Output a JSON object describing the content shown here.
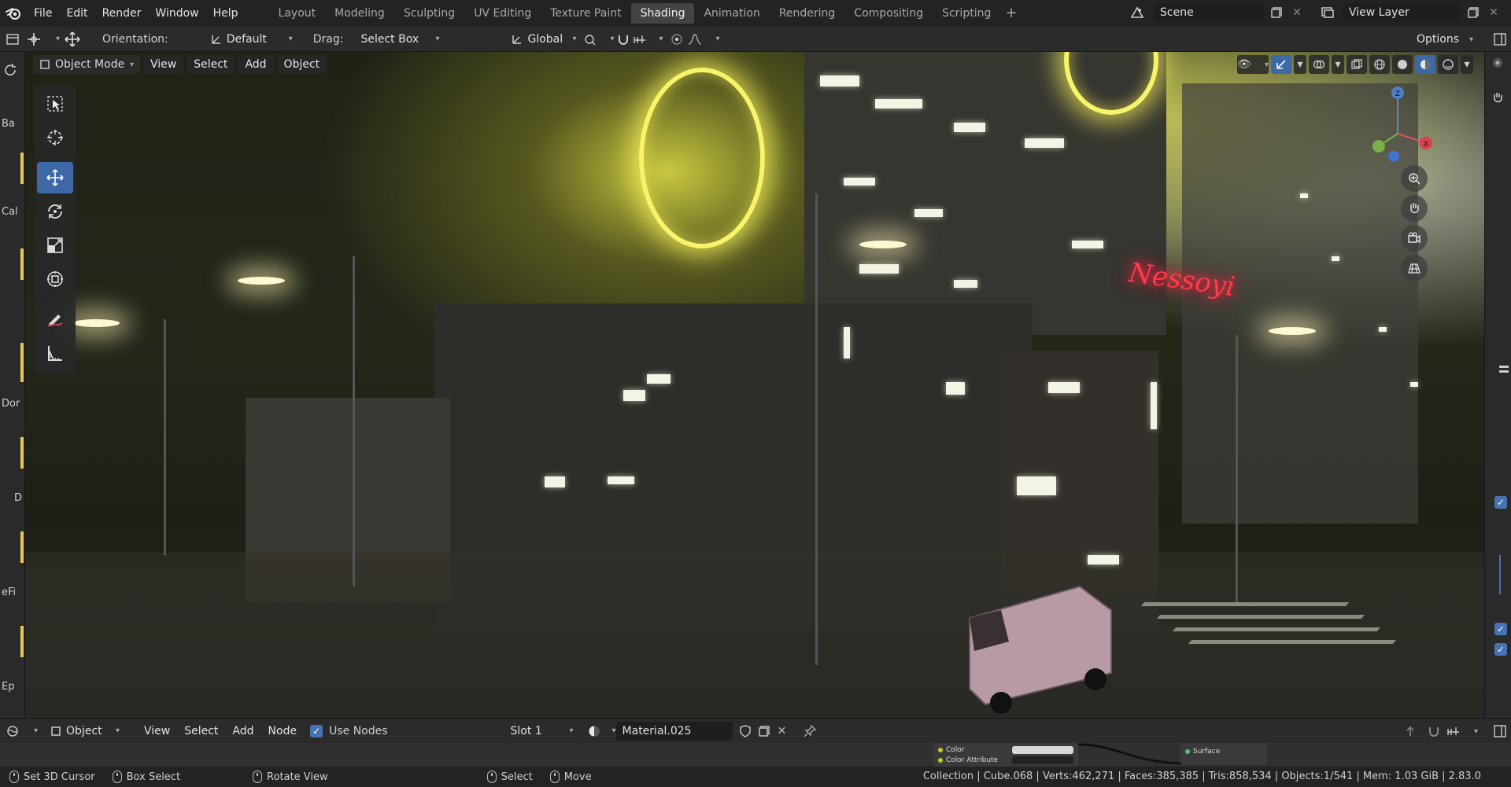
{
  "topbar": {
    "menus": [
      "File",
      "Edit",
      "Render",
      "Window",
      "Help"
    ],
    "workspaces": [
      "Layout",
      "Modeling",
      "Sculpting",
      "UV Editing",
      "Texture Paint",
      "Shading",
      "Animation",
      "Rendering",
      "Compositing",
      "Scripting"
    ],
    "active_workspace": "Shading",
    "add_tab": "+",
    "scene": "Scene",
    "view_layer": "View Layer"
  },
  "toolbar": {
    "orientation_label": "Orientation:",
    "orientation_value": "Default",
    "drag_label": "Drag:",
    "drag_value": "Select Box",
    "transform_space": "Global",
    "options_label": "Options"
  },
  "viewport_header": {
    "mode": "Object Mode",
    "menus": [
      "View",
      "Select",
      "Add",
      "Object"
    ]
  },
  "gizmo": {
    "z": "Z",
    "x": "X"
  },
  "left_strip_fragments": [
    "Ba",
    "Cal",
    "Dor",
    "D",
    "eFi",
    "Ep"
  ],
  "viewport_scene": {
    "neon_sign_text": "Nessoyi"
  },
  "node_editor": {
    "editor_type": "Object",
    "menus": [
      "View",
      "Select",
      "Add",
      "Node"
    ],
    "use_nodes_label": "Use Nodes",
    "use_nodes_checked": true,
    "slot": "Slot 1",
    "material": "Material.025",
    "sockets": [
      "Color",
      "Color Attribute"
    ],
    "output_socket": "Surface"
  },
  "statusbar": {
    "left_items": [
      "Set 3D Cursor",
      "Box Select",
      "Rotate View",
      "Select",
      "Move"
    ],
    "stats": "Collection | Cube.068 | Verts:462,271 | Faces:385,385 | Tris:858,534 | Objects:1/541 | Mem: 1.03 GiB | 2.83.0"
  },
  "colors": {
    "accent_blue": "#4772b3",
    "active_tool": "#3d6aa6",
    "header_bg": "#232323",
    "neon_yellow": "#f8f46a",
    "neon_red": "#ff3b4a"
  }
}
